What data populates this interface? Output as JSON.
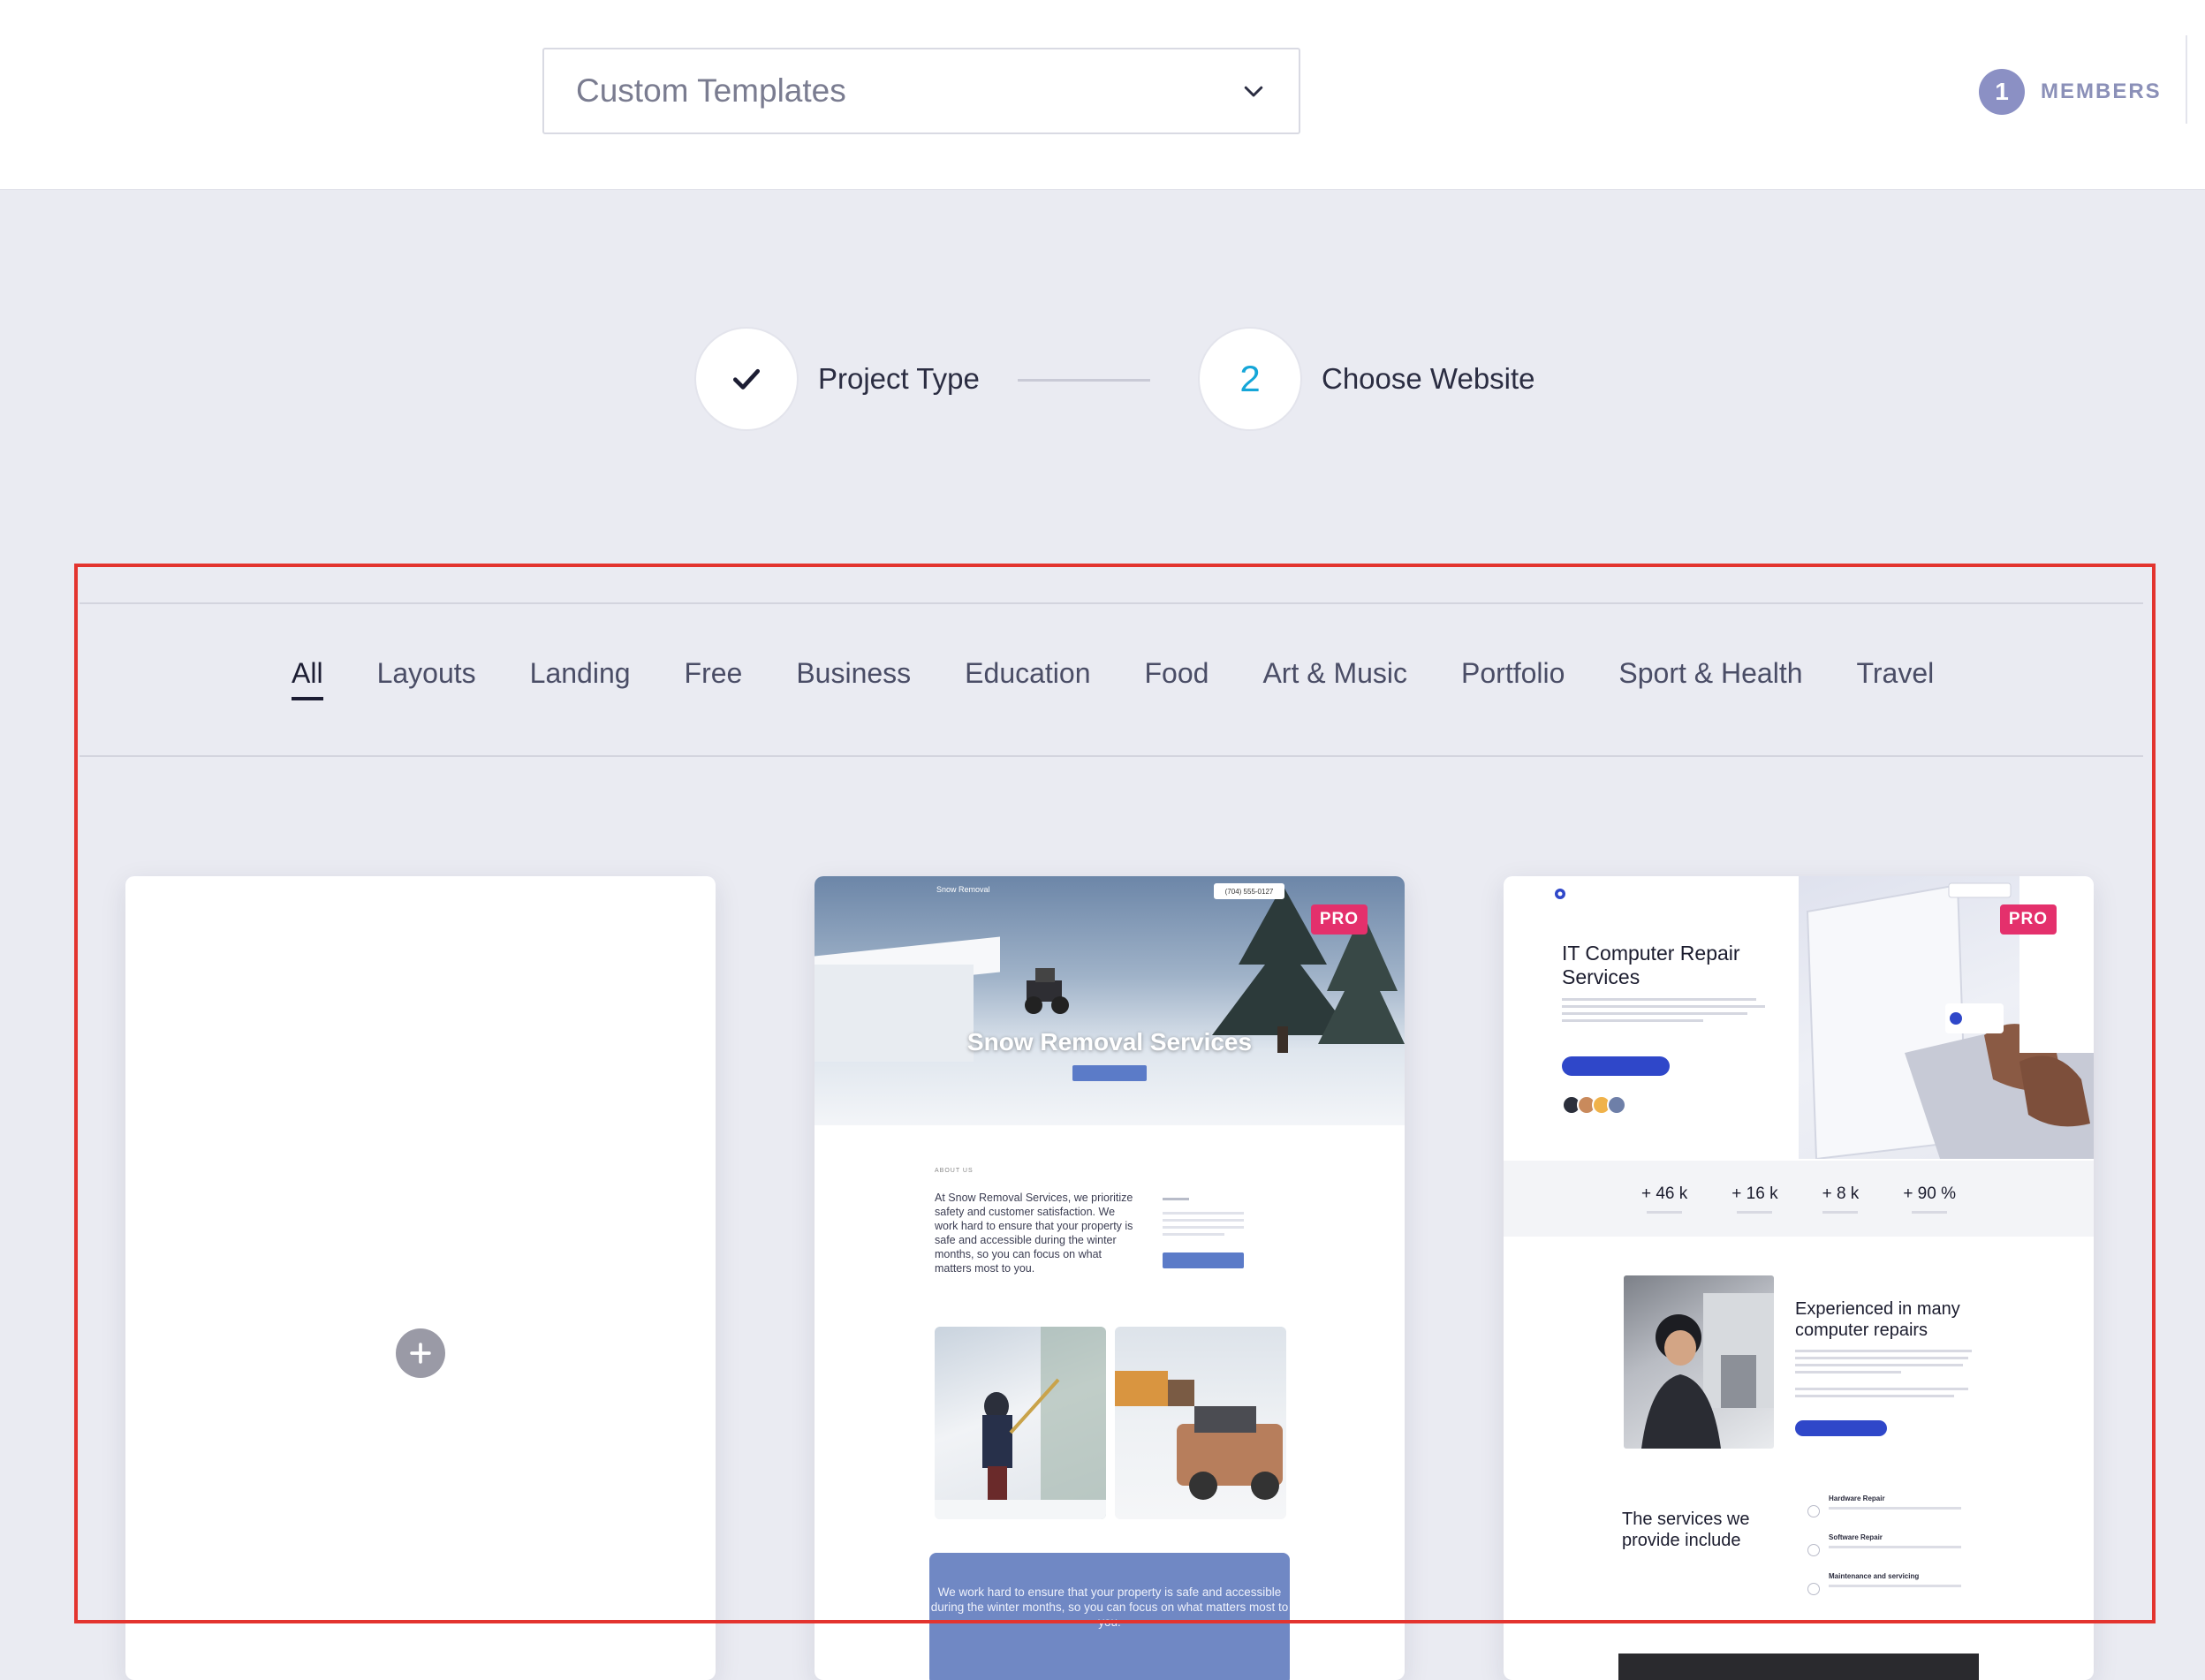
{
  "header": {
    "template_select": {
      "value": "Custom Templates"
    },
    "members": {
      "count": "1",
      "label": "MEMBERS"
    }
  },
  "stepper": {
    "steps": [
      {
        "label": "Project Type",
        "state": "done",
        "icon": "check-icon"
      },
      {
        "label": "Choose Website",
        "number": "2",
        "state": "current"
      }
    ]
  },
  "filters": {
    "tabs": [
      {
        "label": "All",
        "active": true
      },
      {
        "label": "Layouts"
      },
      {
        "label": "Landing"
      },
      {
        "label": "Free"
      },
      {
        "label": "Business"
      },
      {
        "label": "Education"
      },
      {
        "label": "Food"
      },
      {
        "label": "Art & Music"
      },
      {
        "label": "Portfolio"
      },
      {
        "label": "Sport & Health"
      },
      {
        "label": "Travel"
      }
    ]
  },
  "templates": {
    "blank": {
      "icon": "plus-icon"
    },
    "snow": {
      "badge": "PRO",
      "logo": "Snow Removal",
      "phone": "(704) 555-0127",
      "hero_title": "Snow Removal Services",
      "about_label": "ABOUT US",
      "about_text": "At Snow Removal Services, we prioritize safety and customer satisfaction. We work hard to ensure that your property is safe and accessible during the winter months, so you can focus on what matters most to you.",
      "quote_text": "We work hard to ensure that your property is safe and accessible during the winter months, so you can focus on what matters most to you."
    },
    "it": {
      "badge": "PRO",
      "title": "IT Computer Repair Services",
      "stats": [
        "+ 46 k",
        "+ 16 k",
        "+ 8 k",
        "+ 90 %"
      ],
      "experience_title": "Experienced in many computer repairs",
      "services_title": "The services we provide include",
      "services": [
        "Hardware Repair",
        "Software Repair",
        "Maintenance and servicing"
      ]
    }
  },
  "colors": {
    "accent": "#15a6d8",
    "pro": "#e4306c",
    "highlight": "#e3342f"
  }
}
